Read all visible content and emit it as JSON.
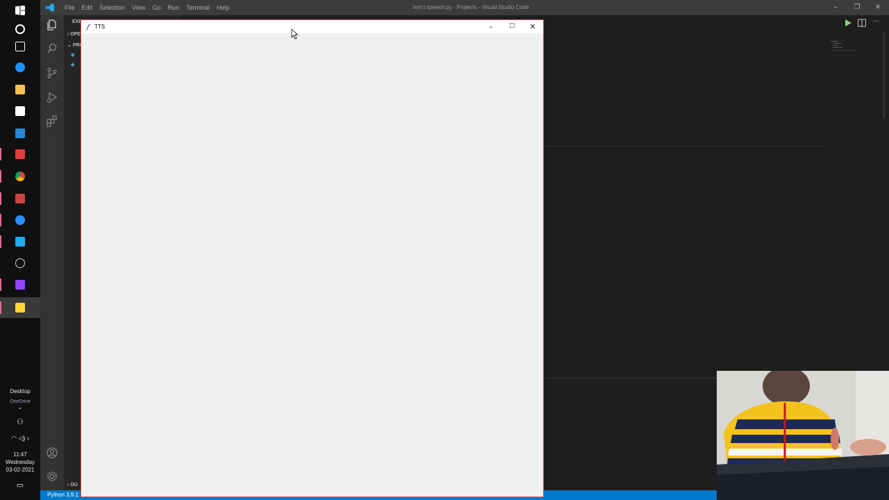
{
  "taskbar": {
    "desktop_label": "Desktop",
    "onedrive_label": "OneDrive",
    "time": "11:47",
    "day": "Wednesday",
    "date": "03-02-2021",
    "icons": [
      {
        "name": "windows-start-icon",
        "color": "#ffffff"
      },
      {
        "name": "cortana-icon",
        "color": "#ffffff"
      },
      {
        "name": "task-view-icon",
        "color": "#ffffff"
      },
      {
        "name": "edge-icon",
        "color": "#1e90ff"
      },
      {
        "name": "file-explorer-icon",
        "color": "#f2c14e"
      },
      {
        "name": "store-icon",
        "color": "#ffffff"
      },
      {
        "name": "mail-icon",
        "color": "#2b88d8"
      },
      {
        "name": "anydesk-icon",
        "color": "#e23c3c"
      },
      {
        "name": "chrome-icon",
        "color": "#e6a817"
      },
      {
        "name": "chrome-app-icon",
        "color": "#c94444"
      },
      {
        "name": "zoom-icon",
        "color": "#2d8cff"
      },
      {
        "name": "vscode-icon",
        "color": "#23a9f2"
      },
      {
        "name": "clock-icon",
        "color": "#cccccc"
      },
      {
        "name": "twitch-icon",
        "color": "#9146ff"
      },
      {
        "name": "python-icon",
        "color": "#ffd43b"
      }
    ]
  },
  "vscode": {
    "menu": [
      "File",
      "Edit",
      "Selection",
      "View",
      "Go",
      "Run",
      "Terminal",
      "Help"
    ],
    "window_title": "text t speach.py - Projects - Visual Studio Code",
    "sidebar": {
      "explorer_label": "EXP",
      "open_editors_label": "OPE",
      "project_label": "PRO",
      "outline_label": "OU"
    },
    "status": "Python 3.9.1"
  },
  "tk_window": {
    "title": "TTS",
    "minimize": "–",
    "maximize": "☐",
    "close": "✕"
  },
  "colors": {
    "taskbar_bg": "#101010",
    "vscode_titlebar": "#3c3c3c",
    "vscode_activitybar": "#333333",
    "vscode_sidebar": "#252526",
    "vscode_editor": "#1e1e1e",
    "statusbar": "#007acc",
    "tk_body": "#f0f0f0",
    "tk_border": "#e9546b"
  }
}
